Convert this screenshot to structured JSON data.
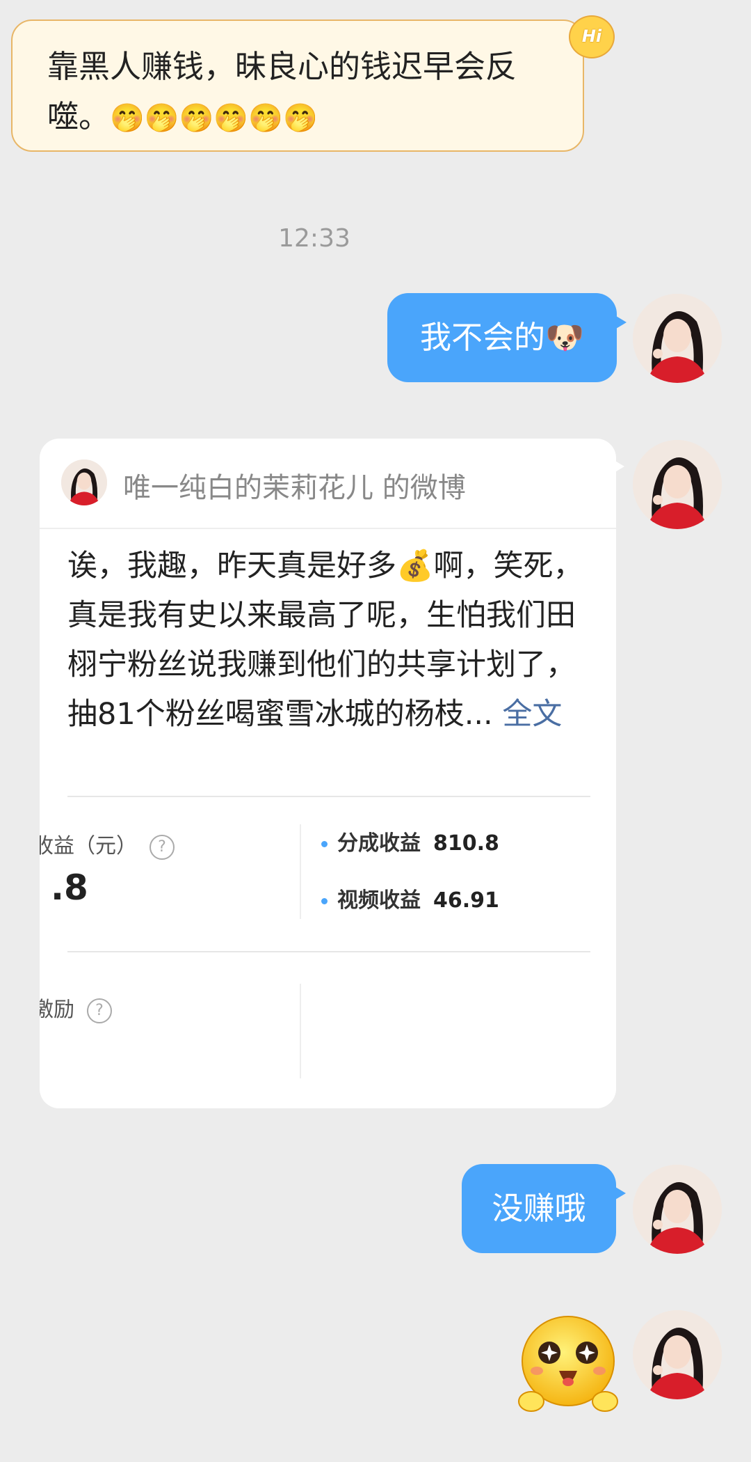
{
  "incoming": {
    "text": "靠黑人赚钱，昧良心的钱迟早会反噬。",
    "emoji": "🤭🤭🤭🤭🤭🤭",
    "badge": "Hi"
  },
  "timestamp": "12:33",
  "messages": [
    {
      "text": "我不会的",
      "emoji": "🐶"
    },
    {
      "text": "没赚哦"
    }
  ],
  "weibo_card": {
    "title": "唯一纯白的茉莉花儿 的微博",
    "body_text": "诶，我趣，昨天真是好多💰啊，笑死，真是我有史以来最高了呢，生怕我们田栩宁粉丝说我赚到他们的共享计划了，抽81个粉丝喝蜜雪冰城的杨枝...",
    "full_link": "全文",
    "stats": {
      "income_label": "收益（元）",
      "income_value": ".8",
      "split_label": "分成收益",
      "split_value": "810.8",
      "video_label": "视频收益",
      "video_value": "46.91",
      "incentive_label": "激励"
    }
  },
  "sticker": "smiling-sparkle-eyes-sticker",
  "colors": {
    "bubble_out": "#4aa5fb",
    "bubble_in": "#fff8e6",
    "bubble_in_border": "#e8b667",
    "background": "#ececec"
  }
}
